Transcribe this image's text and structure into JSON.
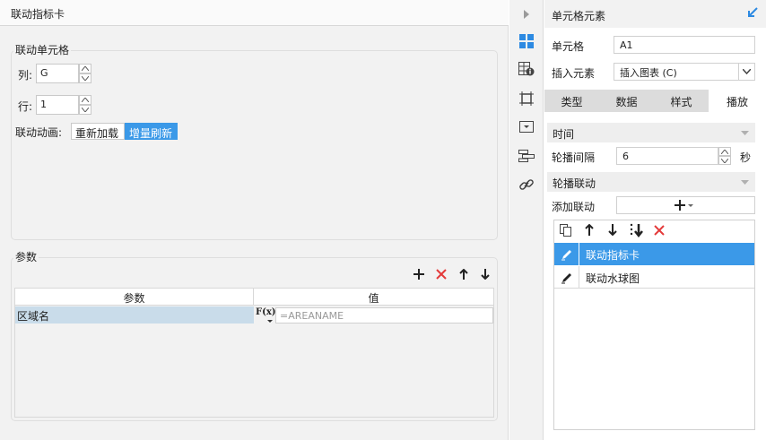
{
  "left_panel": {
    "title": "联动指标卡",
    "cell_group": {
      "legend": "联动单元格",
      "col_label": "列:",
      "col_value": "G",
      "row_label": "行:",
      "row_value": "1",
      "animation_label": "联动动画:",
      "animation_options": [
        "重新加载",
        "增量刷新"
      ],
      "animation_selected": "增量刷新"
    },
    "params_group": {
      "legend": "参数",
      "columns": [
        "参数",
        "值"
      ],
      "rows": [
        {
          "name": "区域名",
          "formula_icon": "F(x)",
          "value": "=AREANAME"
        }
      ]
    }
  },
  "right_panel": {
    "title": "单元格元素",
    "cell_label": "单元格",
    "cell_value": "A1",
    "insert_label": "插入元素",
    "insert_value": "插入图表 (C)",
    "tabs": [
      "类型",
      "数据",
      "样式",
      "播放"
    ],
    "active_tab": "播放",
    "time_section": "时间",
    "interval_label": "轮播间隔",
    "interval_value": "6",
    "interval_unit": "秒",
    "link_section": "轮播联动",
    "add_link_label": "添加联动",
    "link_items": [
      {
        "label": "联动指标卡",
        "selected": true
      },
      {
        "label": "联动水球图",
        "selected": false
      }
    ]
  },
  "colors": {
    "selected_blue": "#3b99e8",
    "param_row_bg": "#c9dcea",
    "delete_red": "#e43a3a",
    "icon_blue": "#2d8ae2"
  }
}
